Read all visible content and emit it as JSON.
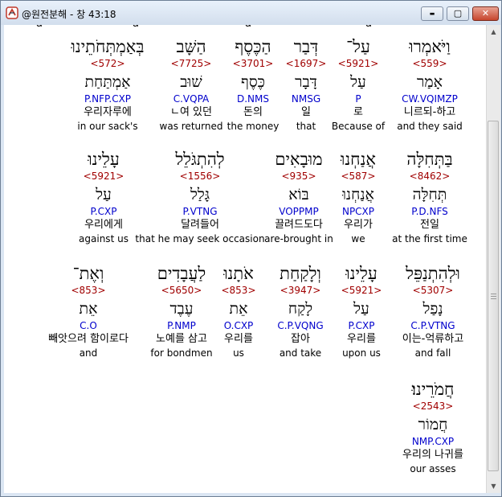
{
  "window": {
    "title": "@원전분해 - 창 43:18",
    "controls": {
      "minimize": "▬",
      "maximize": "▢",
      "close": "✕"
    }
  },
  "top_partial_text": [
    "a",
    "a",
    "a",
    "a"
  ],
  "rows": [
    {
      "words": [
        {
          "hebrew": "וַיֹּאמְרוּ",
          "strong": "<559>",
          "lemma": "אָמַר",
          "code": "CW.VQIMZP",
          "korean": "니르되-하고",
          "english": "and they said"
        },
        {
          "hebrew": "עַל־",
          "strong": "<5921>",
          "lemma": "עַל",
          "code": "P",
          "korean": "로",
          "english": "Because of"
        },
        {
          "hebrew": "דְּבַר",
          "strong": "<1697>",
          "lemma": "דָּבָר",
          "code": "NMSG",
          "korean": "일",
          "english": "that"
        },
        {
          "hebrew": "הַכֶּסֶף",
          "strong": "<3701>",
          "lemma": "כֶּסֶף",
          "code": "D.NMS",
          "korean": "돈의",
          "english": "the money"
        },
        {
          "hebrew": "הַשָּׁב",
          "strong": "<7725>",
          "lemma": "שׁוּב",
          "code": "C.VQPA",
          "korean": "ㄴ여 있던",
          "english": "was returned"
        },
        {
          "hebrew": "בְּאַמְתְּחֹתֵינוּ",
          "strong": "<572>",
          "lemma": "אַמְתַּחַת",
          "code": "P.NFP.CXP",
          "korean": "우리자루에",
          "english": "in our sack's"
        }
      ]
    },
    {
      "words": [
        {
          "hebrew": "בַּתְּחִלָּה",
          "strong": "<8462>",
          "lemma": "תְּחִלָּה",
          "code": "P.D.NFS",
          "korean": "전일",
          "english": "at the first time"
        },
        {
          "hebrew": "אֲנַחְנוּ",
          "strong": "<587>",
          "lemma": "אֲנַחְנוּ",
          "code": "NPCXP",
          "korean": "우리가",
          "english": "we"
        },
        {
          "hebrew": "מוּבָאִים",
          "strong": "<935>",
          "lemma": "בּוֹא",
          "code": "VOPPMP",
          "korean": "끌려드도다",
          "english": "are-brought in"
        },
        {
          "hebrew": "לְהִתְגֹּלֵל",
          "strong": "<1556>",
          "lemma": "גָּלַל",
          "code": "P.VTNG",
          "korean": "달려들어",
          "english": "that he may seek occasion"
        },
        {
          "hebrew": "עָלֵינוּ",
          "strong": "<5921>",
          "lemma": "עַל",
          "code": "P.CXP",
          "korean": "우리에게",
          "english": "against us"
        }
      ]
    },
    {
      "words": [
        {
          "hebrew": "וּלְהִתְנַפֵּל",
          "strong": "<5307>",
          "lemma": "נָפַל",
          "code": "C.P.VTNG",
          "korean": "이는-억류하고",
          "english": "and fall"
        },
        {
          "hebrew": "עָלֵינוּ",
          "strong": "<5921>",
          "lemma": "עַל",
          "code": "P.CXP",
          "korean": "우리를",
          "english": "upon us"
        },
        {
          "hebrew": "וְלָקַחַת",
          "strong": "<3947>",
          "lemma": "לָקַח",
          "code": "C.P.VQNG",
          "korean": "잡아",
          "english": "and take"
        },
        {
          "hebrew": "אֹתָנוּ",
          "strong": "<853>",
          "lemma": "אֵת",
          "code": "O.CXP",
          "korean": "우리를",
          "english": "us"
        },
        {
          "hebrew": "לַעֲבָדִים",
          "strong": "<5650>",
          "lemma": "עֶבֶד",
          "code": "P.NMP",
          "korean": "노예를 삼고",
          "english": "for bondmen"
        },
        {
          "hebrew": "וְאֶת־",
          "strong": "<853>",
          "lemma": "אֵת",
          "code": "C.O",
          "korean": "빼앗으려 함이로다",
          "english": "and"
        }
      ]
    },
    {
      "words": [
        {
          "hebrew": "חֲמֹרֵינוּ׃",
          "strong": "<2543>",
          "lemma": "חֲמוֹר",
          "code": "NMP.CXP",
          "korean": "우리의 나귀를",
          "english": "our asses"
        }
      ]
    }
  ]
}
